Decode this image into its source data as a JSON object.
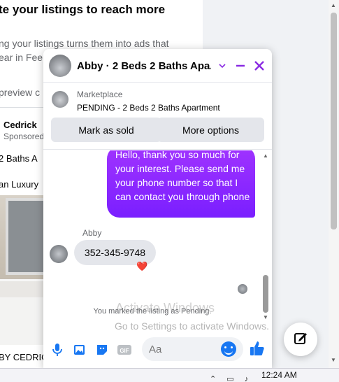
{
  "background_page": {
    "promo_title": "te your listings to reach more",
    "promo_body_line1": "ng your listings turns them into ads that",
    "promo_body_line2": "ear in Fee",
    "promo_preview": "preview c",
    "ad_name": "Cedrick",
    "ad_sponsored": "Sponsored",
    "ad_title": "2 Baths A",
    "ad_subtitle": "an Luxury",
    "ad_footer": "BY CEDRIC"
  },
  "chat": {
    "title": "Abby · 2 Beds 2 Baths Apa...",
    "listing": {
      "source_label": "Marketplace",
      "status": "PENDING - 2 Beds 2 Baths Apartment",
      "mark_sold_label": "Mark as sold",
      "more_options_label": "More options"
    },
    "messages": {
      "outgoing_text": "Hello, thank you so much for your interest. Please send me your phone number so that I can contact you through phone",
      "sender_name": "Abby",
      "incoming_text": "352-345-9748",
      "reaction": "❤️",
      "system_text": "You marked the listing as Pending."
    },
    "composer": {
      "placeholder": "Aa"
    },
    "accent_color": "#8a2be2",
    "link_color": "#1877f2"
  },
  "watermark": {
    "line1": "Activate Windows",
    "line2": "Go to Settings to activate Windows."
  },
  "taskbar": {
    "time": "12:24 AM"
  }
}
